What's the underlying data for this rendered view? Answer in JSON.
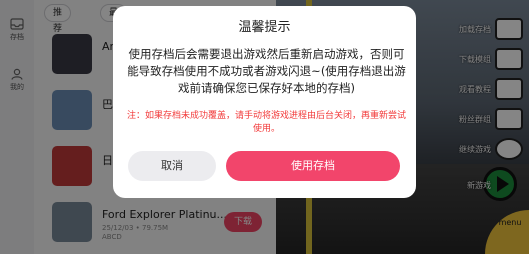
{
  "rail": {
    "items": [
      {
        "label": "存档",
        "icon": "inbox-icon"
      },
      {
        "label": "我的",
        "icon": "user-icon"
      }
    ]
  },
  "list": {
    "chips": [
      "推荐 ▾",
      "最"
    ],
    "rows": [
      {
        "title": "Ar",
        "meta": "",
        "meta2": "",
        "thumb_color": "#3b3b46"
      },
      {
        "title": "巴",
        "meta": "",
        "meta2": "",
        "thumb_color": "#6b8fb7"
      },
      {
        "title": "日",
        "meta": "",
        "meta2": "",
        "thumb_color": "#c23a3a"
      },
      {
        "title": "Ford Explorer Platinu...",
        "meta": "25/12/03 • 79.75M",
        "meta2": "ABCD",
        "thumb_color": "#7a8a99"
      }
    ],
    "download_label": "下载"
  },
  "game": {
    "side_labels": [
      "加载存档",
      "下载模组",
      "观看教程",
      "粉丝群组",
      "继续游戏",
      "新游戏"
    ],
    "menu_label": "menu"
  },
  "dialog": {
    "title": "温馨提示",
    "body": "使用存档后会需要退出游戏然后重新启动游戏，否则可能导致存档使用不成功或者游戏闪退~(使用存档退出游戏前请确保您已保存好本地的存档)",
    "note": "注：如果存档未成功覆盖，请手动将游戏进程由后台关闭，再重新尝试使用。",
    "cancel_label": "取消",
    "confirm_label": "使用存档"
  }
}
